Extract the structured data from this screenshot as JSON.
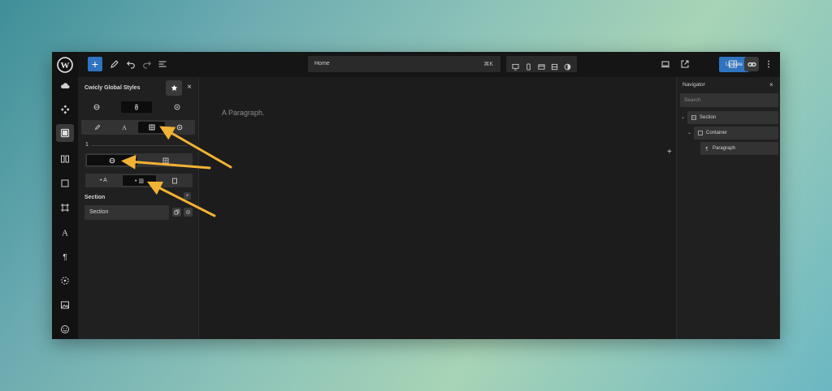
{
  "colors": {
    "accent": "#2f74c0",
    "annotation_arrow": "#f2b233",
    "panel_bg": "#202020",
    "canvas_bg": "#1c1c1c"
  },
  "rail": {
    "items": [
      {
        "icon": "wordpress-icon"
      },
      {
        "icon": "cloud-icon"
      },
      {
        "icon": "blocks-icon"
      },
      {
        "icon": "styles-panel-icon"
      },
      {
        "icon": "columns-icon"
      },
      {
        "icon": "square-icon"
      },
      {
        "icon": "frame-icon"
      },
      {
        "icon": "typography-icon"
      },
      {
        "icon": "paragraph-icon"
      },
      {
        "icon": "color-icon"
      },
      {
        "icon": "image-icon"
      },
      {
        "icon": "emoji-icon"
      }
    ]
  },
  "topbar": {
    "add_label": "+",
    "page_name": "Home",
    "shortcut": "⌘K",
    "update_label": "Update"
  },
  "panel": {
    "title": "Cwicly Global Styles",
    "close_label": "×",
    "slider_marker": "1",
    "font_option_label": "• A",
    "layout_option_label": "• ▥",
    "section_heading": "Section",
    "add_label": "+",
    "class_value": "Section"
  },
  "canvas": {
    "text": "A Paragraph.",
    "add_label": "+"
  },
  "navigator": {
    "title": "Navigator",
    "close_label": "×",
    "search_placeholder": "Search",
    "tree": [
      {
        "label": "Section",
        "depth": 0
      },
      {
        "label": "Container",
        "depth": 1
      },
      {
        "label": "Paragraph",
        "depth": 2
      }
    ]
  }
}
